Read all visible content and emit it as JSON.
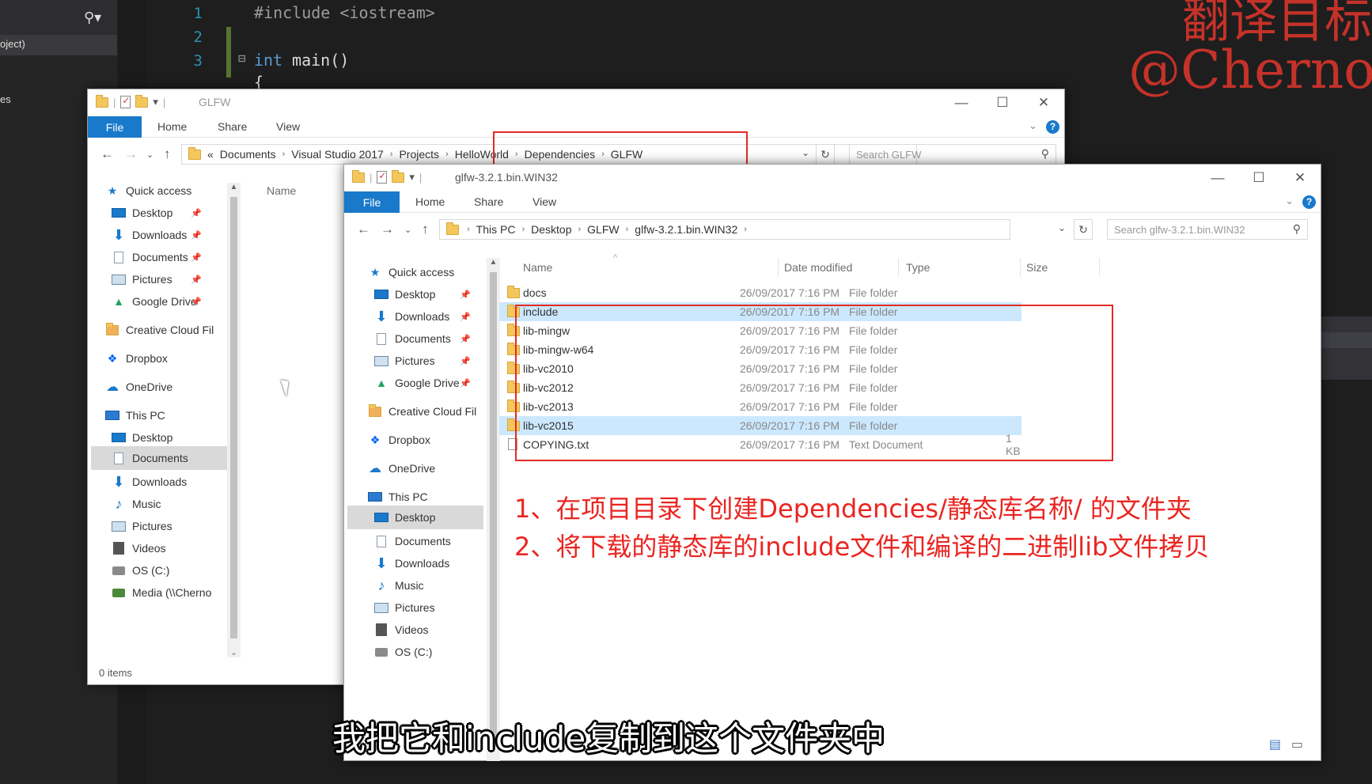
{
  "ide": {
    "left_text_1": "oject)",
    "left_text_2": "es",
    "line_numbers": [
      "1",
      "2",
      "3"
    ],
    "code_line_1": "#include <iostream>",
    "code_line_3_kw": "int",
    "code_line_3_fn": " main()",
    "code_line_4": "{"
  },
  "watermark": {
    "line1": "翻译目标",
    "line2": "@Cherno"
  },
  "win1": {
    "title": "GLFW",
    "ribbon": {
      "file": "File",
      "home": "Home",
      "share": "Share",
      "view": "View"
    },
    "breadcrumb": [
      "«",
      "Documents",
      "Visual Studio 2017",
      "Projects",
      "HelloWorld",
      "Dependencies",
      "GLFW"
    ],
    "search_placeholder": "Search GLFW",
    "column_name": "Name",
    "nav": {
      "quick_access": "Quick access",
      "desktop": "Desktop",
      "downloads": "Downloads",
      "documents": "Documents",
      "pictures": "Pictures",
      "google_drive": "Google Drive",
      "creative_cloud": "Creative Cloud Fil",
      "dropbox": "Dropbox",
      "onedrive": "OneDrive",
      "this_pc": "This PC",
      "pc_desktop": "Desktop",
      "pc_documents": "Documents",
      "pc_downloads": "Downloads",
      "pc_music": "Music",
      "pc_pictures": "Pictures",
      "pc_videos": "Videos",
      "pc_osc": "OS (C:)",
      "pc_media": "Media (\\\\Cherno"
    },
    "status": "0 items"
  },
  "win2": {
    "title": "glfw-3.2.1.bin.WIN32",
    "ribbon": {
      "file": "File",
      "home": "Home",
      "share": "Share",
      "view": "View"
    },
    "breadcrumb": [
      "This PC",
      "Desktop",
      "GLFW",
      "glfw-3.2.1.bin.WIN32"
    ],
    "search_placeholder": "Search glfw-3.2.1.bin.WIN32",
    "columns": {
      "name": "Name",
      "date": "Date modified",
      "type": "Type",
      "size": "Size"
    },
    "files": [
      {
        "name": "docs",
        "date": "26/09/2017 7:16 PM",
        "type": "File folder",
        "size": "",
        "selected": false
      },
      {
        "name": "include",
        "date": "26/09/2017 7:16 PM",
        "type": "File folder",
        "size": "",
        "selected": true
      },
      {
        "name": "lib-mingw",
        "date": "26/09/2017 7:16 PM",
        "type": "File folder",
        "size": "",
        "selected": false
      },
      {
        "name": "lib-mingw-w64",
        "date": "26/09/2017 7:16 PM",
        "type": "File folder",
        "size": "",
        "selected": false
      },
      {
        "name": "lib-vc2010",
        "date": "26/09/2017 7:16 PM",
        "type": "File folder",
        "size": "",
        "selected": false
      },
      {
        "name": "lib-vc2012",
        "date": "26/09/2017 7:16 PM",
        "type": "File folder",
        "size": "",
        "selected": false
      },
      {
        "name": "lib-vc2013",
        "date": "26/09/2017 7:16 PM",
        "type": "File folder",
        "size": "",
        "selected": false
      },
      {
        "name": "lib-vc2015",
        "date": "26/09/2017 7:16 PM",
        "type": "File folder",
        "size": "",
        "selected": true
      },
      {
        "name": "COPYING.txt",
        "date": "26/09/2017 7:16 PM",
        "type": "Text Document",
        "size": "1 KB",
        "selected": false
      }
    ],
    "nav": {
      "quick_access": "Quick access",
      "desktop": "Desktop",
      "downloads": "Downloads",
      "documents": "Documents",
      "pictures": "Pictures",
      "google_drive": "Google Drive",
      "creative_cloud": "Creative Cloud Fil",
      "dropbox": "Dropbox",
      "onedrive": "OneDrive",
      "this_pc": "This PC",
      "pc_desktop": "Desktop",
      "pc_documents": "Documents",
      "pc_downloads": "Downloads",
      "pc_music": "Music",
      "pc_pictures": "Pictures",
      "pc_videos": "Videos",
      "pc_osc": "OS (C:)"
    }
  },
  "annotations": {
    "note1": "1、在项目目录下创建Dependencies/静态库名称/ 的文件夹",
    "note2": "2、将下载的静态库的include文件和编译的二进制lib文件拷贝"
  },
  "subtitle": "我把它和include复制到这个文件夹中",
  "colors": {
    "accent": "#1979ca",
    "highlight_red": "#e32a26",
    "selection": "#cce8ff"
  }
}
